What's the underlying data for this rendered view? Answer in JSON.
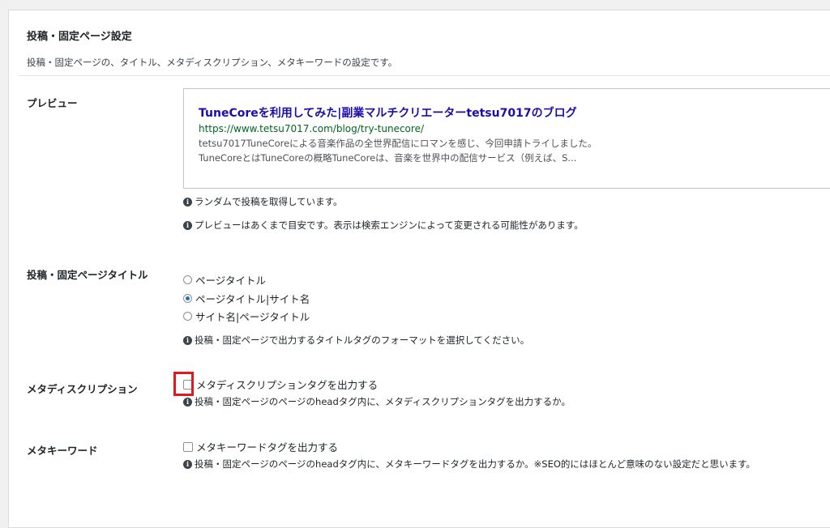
{
  "section": {
    "title": "投稿・固定ページ設定",
    "description": "投稿・固定ページの、タイトル、メタディスクリプション、メタキーワードの設定です。"
  },
  "preview": {
    "label": "プレビュー",
    "title": "TuneCoreを利用してみた|副業マルチクリエーターtetsu7017のブログ",
    "url": "https://www.tetsu7017.com/blog/try-tunecore/",
    "description": "tetsu7017TuneCoreによる音楽作品の全世界配信にロマンを感じ、今回申請トライしました。TuneCoreとはTuneCoreの概略TuneCoreは、音楽を世界中の配信サービス（例えば、S...",
    "note1": "ランダムで投稿を取得しています。",
    "note2": "プレビューはあくまで目安です。表示は検索エンジンによって変更される可能性があります。"
  },
  "title_setting": {
    "label": "投稿・固定ページタイトル",
    "options": [
      "ページタイトル",
      "ページタイトル|サイト名",
      "サイト名|ページタイトル"
    ],
    "selected": "ページタイトル|サイト名",
    "note": "投稿・固定ページで出力するタイトルタグのフォーマットを選択してください。"
  },
  "meta_description": {
    "label": "メタディスクリプション",
    "checkbox_label": "メタディスクリプションタグを出力する",
    "checked": false,
    "note": "投稿・固定ページのページのheadタグ内に、メタディスクリプションタグを出力するか。"
  },
  "meta_keywords": {
    "label": "メタキーワード",
    "checkbox_label": "メタキーワードタグを出力する",
    "checked": false,
    "note": "投稿・固定ページのページのheadタグ内に、メタキーワードタグを出力するか。※SEO的にはほとんど意味のない設定だと思います。"
  },
  "icons": {
    "info": "info-circle-icon"
  },
  "colors": {
    "highlight": "#e1191e",
    "link_title": "#1a0dab",
    "url": "#006621"
  }
}
